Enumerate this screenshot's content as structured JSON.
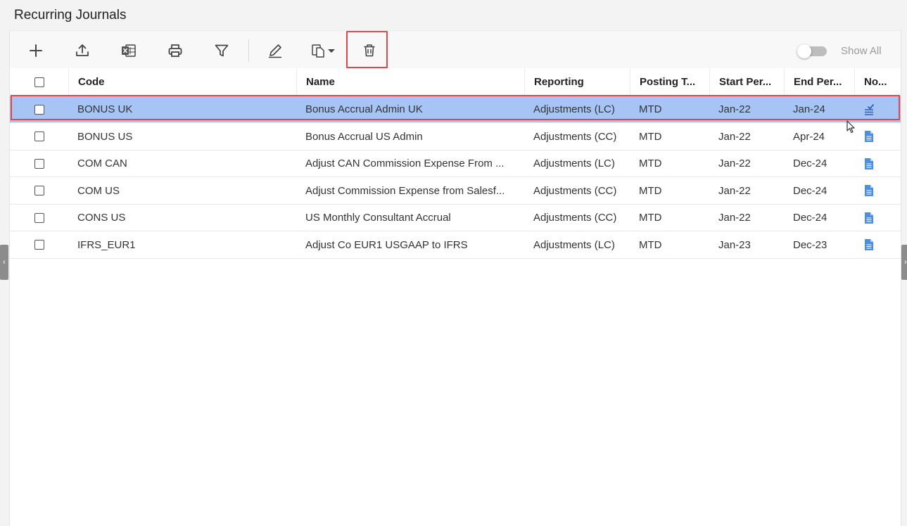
{
  "page": {
    "title": "Recurring Journals"
  },
  "toolbar": {
    "buttons": [
      {
        "name": "add",
        "icon": "plus-icon"
      },
      {
        "name": "import",
        "icon": "upload-icon"
      },
      {
        "name": "export-excel",
        "icon": "excel-icon"
      },
      {
        "name": "print",
        "icon": "printer-icon"
      },
      {
        "name": "filter",
        "icon": "funnel-icon"
      },
      {
        "name": "edit",
        "icon": "pencil-icon"
      },
      {
        "name": "copy",
        "icon": "copy-icon"
      },
      {
        "name": "delete",
        "icon": "trash-icon"
      }
    ],
    "show_all_label": "Show All",
    "show_all_on": false
  },
  "grid": {
    "columns": [
      "Code",
      "Name",
      "Reporting",
      "Posting T...",
      "Start Per...",
      "End Per...",
      "No..."
    ],
    "rows": [
      {
        "code": "BONUS UK",
        "name": "Bonus Accrual Admin UK",
        "reporting": "Adjustments (LC)",
        "posting": "MTD",
        "start": "Jan-22",
        "end": "Jan-24",
        "note_icon": "note-check-icon",
        "selected": true
      },
      {
        "code": "BONUS US",
        "name": "Bonus Accrual US Admin",
        "reporting": "Adjustments (CC)",
        "posting": "MTD",
        "start": "Jan-22",
        "end": "Apr-24",
        "note_icon": "document-icon",
        "selected": false
      },
      {
        "code": "COM CAN",
        "name": "Adjust CAN Commission Expense From ...",
        "reporting": "Adjustments (LC)",
        "posting": "MTD",
        "start": "Jan-22",
        "end": "Dec-24",
        "note_icon": "document-icon",
        "selected": false
      },
      {
        "code": "COM US",
        "name": "Adjust Commission Expense from Salesf...",
        "reporting": "Adjustments (CC)",
        "posting": "MTD",
        "start": "Jan-22",
        "end": "Dec-24",
        "note_icon": "document-icon",
        "selected": false
      },
      {
        "code": "CONS US",
        "name": "US Monthly Consultant Accrual",
        "reporting": "Adjustments (CC)",
        "posting": "MTD",
        "start": "Jan-22",
        "end": "Dec-24",
        "note_icon": "document-icon",
        "selected": false
      },
      {
        "code": "IFRS_EUR1",
        "name": "Adjust Co EUR1 USGAAP to IFRS",
        "reporting": "Adjustments (LC)",
        "posting": "MTD",
        "start": "Jan-23",
        "end": "Dec-23",
        "note_icon": "document-icon",
        "selected": false
      }
    ]
  },
  "colors": {
    "selected_row": "#a6c5f5",
    "highlight": "#e0464b",
    "note_icon": "#4a8fe0"
  }
}
